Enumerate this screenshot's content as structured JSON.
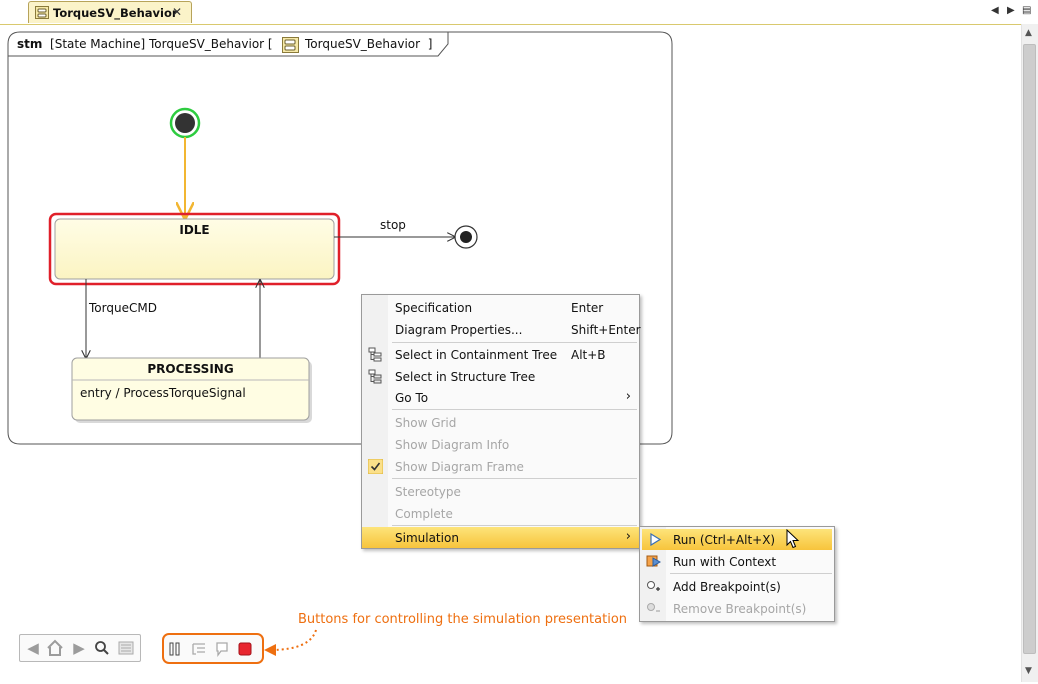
{
  "tab": {
    "title": "TorqueSV_Behavior",
    "close": "✕",
    "nav_prev": "◀",
    "nav_next": "▶",
    "nav_list": "▤"
  },
  "frame": {
    "keyword": "stm",
    "title_prefix": "[State Machine] TorqueSV_Behavior [",
    "title_owner": "TorqueSV_Behavior",
    "title_suffix": "]"
  },
  "states": {
    "idle": {
      "name": "IDLE"
    },
    "processing": {
      "name": "PROCESSING",
      "entry": "entry / ProcessTorqueSignal"
    }
  },
  "transitions": {
    "stop": "stop",
    "torque_cmd": "TorqueCMD"
  },
  "context_menu": {
    "items": [
      {
        "label": "Specification",
        "shortcut": "Enter"
      },
      {
        "label": "Diagram Properties...",
        "shortcut": "Shift+Enter"
      },
      {
        "label": "Select in Containment Tree",
        "shortcut": "Alt+B",
        "icon": "containment-tree-icon"
      },
      {
        "label": "Select in Structure Tree",
        "shortcut": "",
        "icon": "structure-tree-icon"
      },
      {
        "label": "Go To",
        "shortcut": "",
        "submenu": true
      },
      {
        "label": "Show Grid",
        "disabled": true
      },
      {
        "label": "Show Diagram Info",
        "disabled": true
      },
      {
        "label": "Show Diagram Frame",
        "disabled": true,
        "checked": true
      },
      {
        "label": "Stereotype",
        "disabled": true
      },
      {
        "label": "Complete",
        "disabled": true
      },
      {
        "label": "Simulation",
        "submenu": true,
        "highlighted": true
      }
    ],
    "submenu_arrow": "›"
  },
  "simulation_submenu": {
    "items": [
      {
        "label": "Run (Ctrl+Alt+X)",
        "icon": "run-icon",
        "highlighted": true
      },
      {
        "label": "Run with Context",
        "icon": "run-with-context-icon"
      },
      {
        "label": "Add Breakpoint(s)",
        "icon": "add-breakpoint-icon"
      },
      {
        "label": "Remove Breakpoint(s)",
        "icon": "remove-breakpoint-icon",
        "disabled": true
      }
    ]
  },
  "annotation": "Buttons for controlling the simulation presentation",
  "colors": {
    "accent_orange": "#ee6f10",
    "idle_border": "#e0202a",
    "initial_ring": "#2ecc40",
    "transition_orange": "#f2b631",
    "menu_highlight": "#f9d55a"
  }
}
